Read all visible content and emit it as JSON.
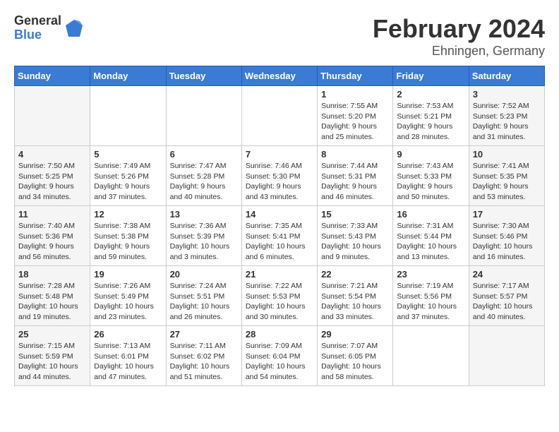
{
  "header": {
    "logo_general": "General",
    "logo_blue": "Blue",
    "month": "February 2024",
    "location": "Ehningen, Germany"
  },
  "days_of_week": [
    "Sunday",
    "Monday",
    "Tuesday",
    "Wednesday",
    "Thursday",
    "Friday",
    "Saturday"
  ],
  "weeks": [
    [
      {
        "day": "",
        "info": ""
      },
      {
        "day": "",
        "info": ""
      },
      {
        "day": "",
        "info": ""
      },
      {
        "day": "",
        "info": ""
      },
      {
        "day": "1",
        "info": "Sunrise: 7:55 AM\nSunset: 5:20 PM\nDaylight: 9 hours\nand 25 minutes."
      },
      {
        "day": "2",
        "info": "Sunrise: 7:53 AM\nSunset: 5:21 PM\nDaylight: 9 hours\nand 28 minutes."
      },
      {
        "day": "3",
        "info": "Sunrise: 7:52 AM\nSunset: 5:23 PM\nDaylight: 9 hours\nand 31 minutes."
      }
    ],
    [
      {
        "day": "4",
        "info": "Sunrise: 7:50 AM\nSunset: 5:25 PM\nDaylight: 9 hours\nand 34 minutes."
      },
      {
        "day": "5",
        "info": "Sunrise: 7:49 AM\nSunset: 5:26 PM\nDaylight: 9 hours\nand 37 minutes."
      },
      {
        "day": "6",
        "info": "Sunrise: 7:47 AM\nSunset: 5:28 PM\nDaylight: 9 hours\nand 40 minutes."
      },
      {
        "day": "7",
        "info": "Sunrise: 7:46 AM\nSunset: 5:30 PM\nDaylight: 9 hours\nand 43 minutes."
      },
      {
        "day": "8",
        "info": "Sunrise: 7:44 AM\nSunset: 5:31 PM\nDaylight: 9 hours\nand 46 minutes."
      },
      {
        "day": "9",
        "info": "Sunrise: 7:43 AM\nSunset: 5:33 PM\nDaylight: 9 hours\nand 50 minutes."
      },
      {
        "day": "10",
        "info": "Sunrise: 7:41 AM\nSunset: 5:35 PM\nDaylight: 9 hours\nand 53 minutes."
      }
    ],
    [
      {
        "day": "11",
        "info": "Sunrise: 7:40 AM\nSunset: 5:36 PM\nDaylight: 9 hours\nand 56 minutes."
      },
      {
        "day": "12",
        "info": "Sunrise: 7:38 AM\nSunset: 5:38 PM\nDaylight: 9 hours\nand 59 minutes."
      },
      {
        "day": "13",
        "info": "Sunrise: 7:36 AM\nSunset: 5:39 PM\nDaylight: 10 hours\nand 3 minutes."
      },
      {
        "day": "14",
        "info": "Sunrise: 7:35 AM\nSunset: 5:41 PM\nDaylight: 10 hours\nand 6 minutes."
      },
      {
        "day": "15",
        "info": "Sunrise: 7:33 AM\nSunset: 5:43 PM\nDaylight: 10 hours\nand 9 minutes."
      },
      {
        "day": "16",
        "info": "Sunrise: 7:31 AM\nSunset: 5:44 PM\nDaylight: 10 hours\nand 13 minutes."
      },
      {
        "day": "17",
        "info": "Sunrise: 7:30 AM\nSunset: 5:46 PM\nDaylight: 10 hours\nand 16 minutes."
      }
    ],
    [
      {
        "day": "18",
        "info": "Sunrise: 7:28 AM\nSunset: 5:48 PM\nDaylight: 10 hours\nand 19 minutes."
      },
      {
        "day": "19",
        "info": "Sunrise: 7:26 AM\nSunset: 5:49 PM\nDaylight: 10 hours\nand 23 minutes."
      },
      {
        "day": "20",
        "info": "Sunrise: 7:24 AM\nSunset: 5:51 PM\nDaylight: 10 hours\nand 26 minutes."
      },
      {
        "day": "21",
        "info": "Sunrise: 7:22 AM\nSunset: 5:53 PM\nDaylight: 10 hours\nand 30 minutes."
      },
      {
        "day": "22",
        "info": "Sunrise: 7:21 AM\nSunset: 5:54 PM\nDaylight: 10 hours\nand 33 minutes."
      },
      {
        "day": "23",
        "info": "Sunrise: 7:19 AM\nSunset: 5:56 PM\nDaylight: 10 hours\nand 37 minutes."
      },
      {
        "day": "24",
        "info": "Sunrise: 7:17 AM\nSunset: 5:57 PM\nDaylight: 10 hours\nand 40 minutes."
      }
    ],
    [
      {
        "day": "25",
        "info": "Sunrise: 7:15 AM\nSunset: 5:59 PM\nDaylight: 10 hours\nand 44 minutes."
      },
      {
        "day": "26",
        "info": "Sunrise: 7:13 AM\nSunset: 6:01 PM\nDaylight: 10 hours\nand 47 minutes."
      },
      {
        "day": "27",
        "info": "Sunrise: 7:11 AM\nSunset: 6:02 PM\nDaylight: 10 hours\nand 51 minutes."
      },
      {
        "day": "28",
        "info": "Sunrise: 7:09 AM\nSunset: 6:04 PM\nDaylight: 10 hours\nand 54 minutes."
      },
      {
        "day": "29",
        "info": "Sunrise: 7:07 AM\nSunset: 6:05 PM\nDaylight: 10 hours\nand 58 minutes."
      },
      {
        "day": "",
        "info": ""
      },
      {
        "day": "",
        "info": ""
      }
    ]
  ]
}
